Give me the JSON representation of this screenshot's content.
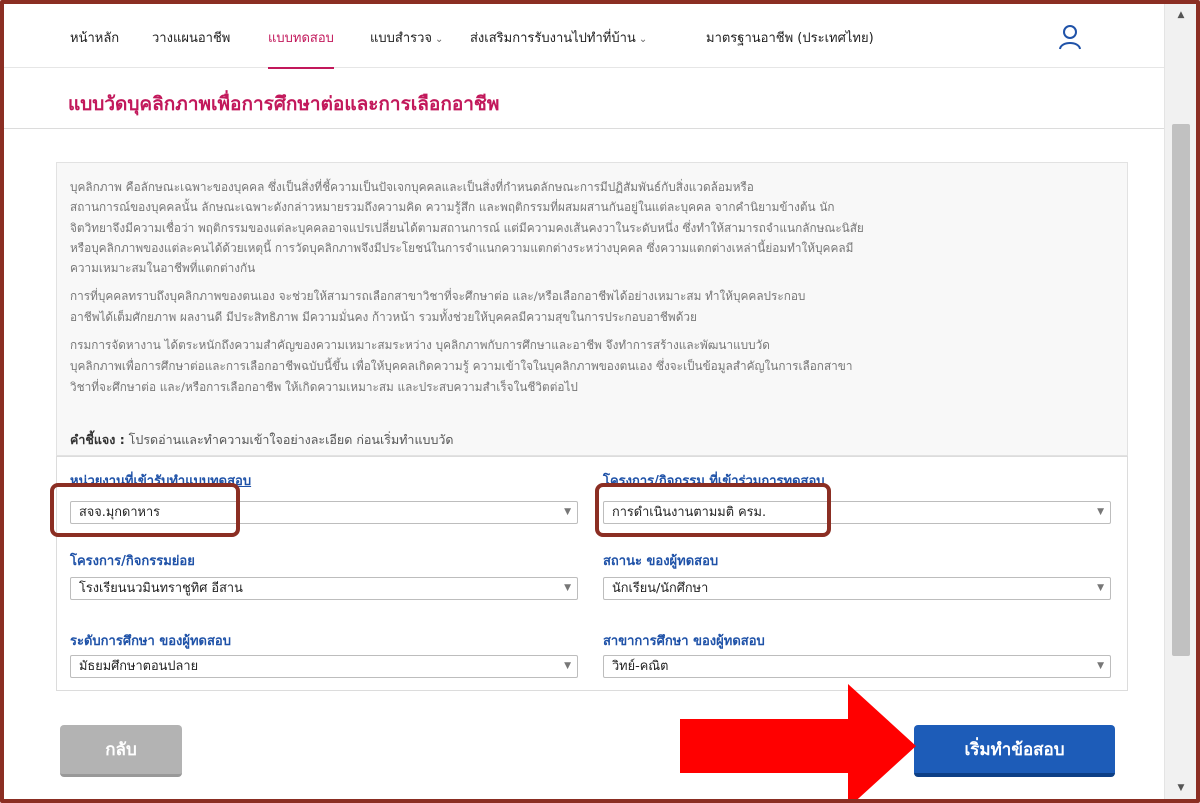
{
  "nav": {
    "items": [
      {
        "label": "หน้าหลัก",
        "has_dropdown": false
      },
      {
        "label": "วางแผนอาชีพ",
        "has_dropdown": false
      },
      {
        "label": "แบบทดสอบ",
        "has_dropdown": false,
        "active": true
      },
      {
        "label": "แบบสำรวจ",
        "has_dropdown": true
      },
      {
        "label": "ส่งเสริมการรับงานไปทำที่บ้าน",
        "has_dropdown": true
      },
      {
        "label": "มาตรฐานอาชีพ (ประเทศไทย)",
        "has_dropdown": false
      }
    ],
    "dropdown_icon": "chevron-down-icon",
    "user_icon": "user-icon",
    "active_color": "#c2185b"
  },
  "page": {
    "title": "แบบวัดบุคลิกภาพเพื่อการศึกษาต่อและการเลือกอาชีพ",
    "title_color": "#c2185b"
  },
  "intro": {
    "lines": [
      "           บุคลิกภาพ คือลักษณะเฉพาะของบุคคล ซึ่งเป็นสิ่งที่ชี้ความเป็นปัจเจกบุคคลและเป็นสิ่งที่กำหนดลักษณะการมีปฏิสัมพันธ์กับสิ่งแวดล้อมหรือ",
      "สถานการณ์ของบุคคลนั้น ลักษณะเฉพาะดังกล่าวหมายรวมถึงความคิด ความรู้สึก และพฤติกรรมที่ผสมผสานกันอยู่ในแต่ละบุคคล จากคำนิยามข้างต้น นัก",
      "จิตวิทยาจึงมีความเชื่อว่า พฤติกรรมของแต่ละบุคคลอาจแปรเปลี่ยนได้ตามสถานการณ์ แต่มีความคงเส้นคงวาในระดับหนึ่ง ซึ่งทำให้สามารถจำแนกลักษณะนิสัย",
      "หรือบุคลิกภาพของแต่ละคนได้ด้วยเหตุนี้ การวัดบุคลิกภาพจึงมีประโยชน์ในการจำแนกความแตกต่างระหว่างบุคคล ซึ่งความแตกต่างเหล่านี้ย่อมทำให้บุคคลมี",
      "ความเหมาะสมในอาชีพที่แตกต่างกัน",
      "           การที่บุคคลทราบถึงบุคลิกภาพของตนเอง จะช่วยให้สามารถเลือกสาขาวิชาที่จะศึกษาต่อ และ/หรือเลือกอาชีพได้อย่างเหมาะสม ทำให้บุคคลประกอบ",
      "อาชีพได้เต็มศักยภาพ ผลงานดี มีประสิทธิภาพ มีความมั่นคง ก้าวหน้า รวมทั้งช่วยให้บุคคลมีความสุขในการประกอบอาชีพด้วย",
      "           กรมการจัดหางาน ได้ตระหนักถึงความสำคัญของความเหมาะสมระหว่าง บุคลิกภาพกับการศึกษาและอาชีพ จึงทำการสร้างและพัฒนาแบบวัด",
      "บุคลิกภาพเพื่อการศึกษาต่อและการเลือกอาชีพฉบับนี้ขึ้น เพื่อให้บุคคลเกิดความรู้ ความเข้าใจในบุคลิกภาพของตนเอง ซึ่งจะเป็นข้อมูลสำคัญในการเลือกสาขา",
      "วิชาที่จะศึกษาต่อ และ/หรือการเลือกอาชีพ ให้เกิดความเหมาะสม และประสบความสำเร็จในชีวิตต่อไป"
    ],
    "note_label": "คำชี้แจง :",
    "note_text": " โปรดอ่านและทำความเข้าใจอย่างละเอียด ก่อนเริ่มทำแบบวัด"
  },
  "form": {
    "agency": {
      "label": "หน่วยงานที่เข้ารับทำแบบทดสอบ",
      "value": "สจจ.มุกดาหาร"
    },
    "project": {
      "label": "โครงการ/กิจกรรม ที่เข้าร่วมการทดสอบ",
      "value": "การดำเนินงานตามมติ ครม."
    },
    "subproject": {
      "label": "โครงการ/กิจกรรมย่อย",
      "value": "โรงเรียนนวมินทราชูทิศ อีสาน"
    },
    "status": {
      "label": "สถานะ ของผู้ทดสอบ",
      "value": "นักเรียน/นักศึกษา"
    },
    "edu_level": {
      "label": "ระดับการศึกษา ของผู้ทดสอบ",
      "value": "มัธยมศึกษาตอนปลาย"
    },
    "major": {
      "label": "สาขาการศึกษา ของผู้ทดสอบ",
      "value": "วิทย์-คณิต"
    },
    "label_color": "#1f52a8"
  },
  "buttons": {
    "back": "กลับ",
    "start": "เริ่มทำข้อสอบ"
  },
  "annotation": {
    "arrow_color": "#ff0000",
    "highlight_color": "#8b2e23"
  },
  "scrollbar": {
    "up_icon": "triangle-up-icon",
    "down_icon": "triangle-down-icon"
  }
}
